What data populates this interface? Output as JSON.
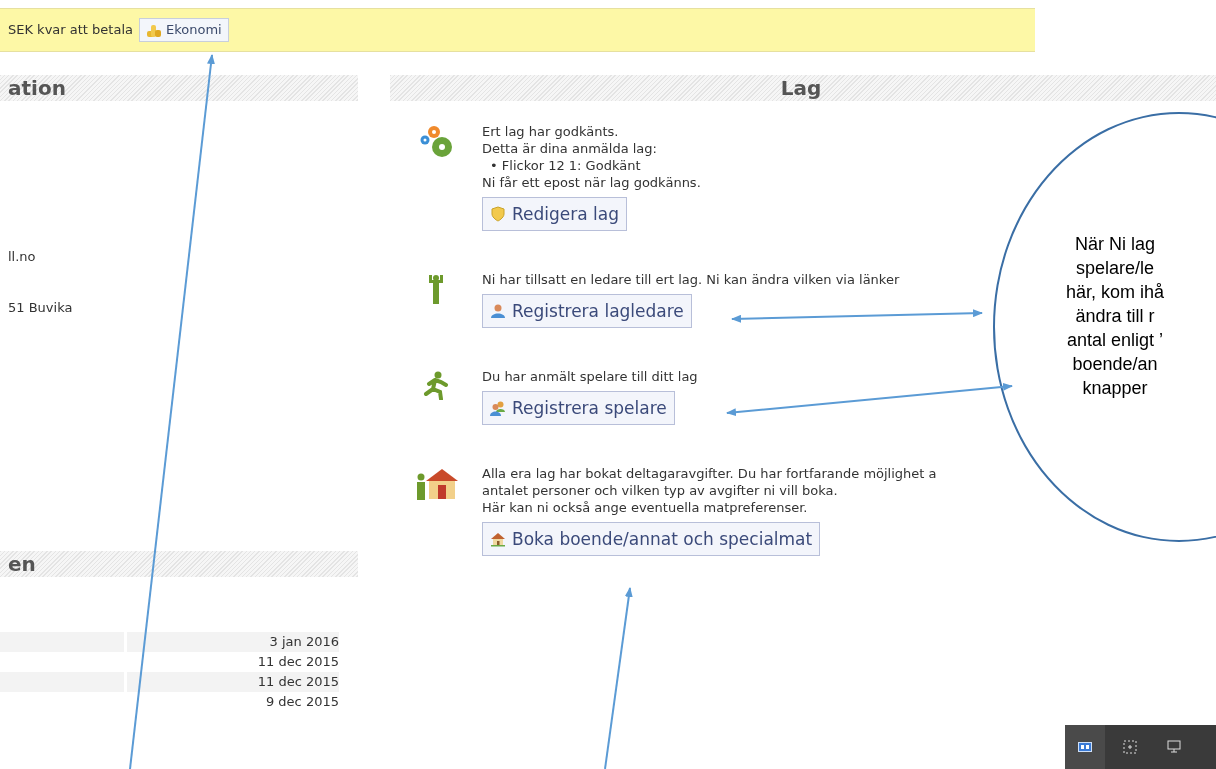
{
  "notice_bar": {
    "text": "SEK kvar att betala",
    "button": "Ekonomi"
  },
  "left_panel": {
    "header": "ation",
    "lines": [
      "ll.no",
      "51 Buvika"
    ],
    "second_header": "en",
    "dates": [
      "3 jan 2016",
      "11 dec 2015",
      "11 dec 2015",
      "9 dec 2015"
    ]
  },
  "team_panel": {
    "header": "Lag",
    "sections": [
      {
        "kind": "gears",
        "lines": [
          "Ert lag har godkänts.",
          "Detta är dina anmälda lag:"
        ],
        "bullets": [
          {
            "mark": "•",
            "text": "Flickor 12 1: Godkänt"
          }
        ],
        "after": [
          "Ni får ett epost när lag godkänns."
        ],
        "button": "Redigera lag"
      },
      {
        "kind": "leader",
        "lines": [
          "Ni har tillsatt en ledare till ert lag. Ni kan ändra vilken via länker"
        ],
        "button": "Registrera lagledare"
      },
      {
        "kind": "runner",
        "lines": [
          "Du har anmält spelare till ditt lag"
        ],
        "button": "Registrera spelare"
      },
      {
        "kind": "house",
        "lines": [
          "Alla era lag har bokat deltagaravgifter. Du har fortfarande möjlighet a",
          "antalet personer och vilken typ av avgifter ni vill boka.",
          "Här kan ni också ange eventuella matpreferenser."
        ],
        "button": "Boka boende/annat och specialmat"
      }
    ]
  },
  "annotation": {
    "lines": [
      "När Ni lag",
      "spelare/le",
      "här, kom ihå",
      "ändra till r",
      "antal enligt ’",
      "boende/an",
      "knapper"
    ]
  }
}
